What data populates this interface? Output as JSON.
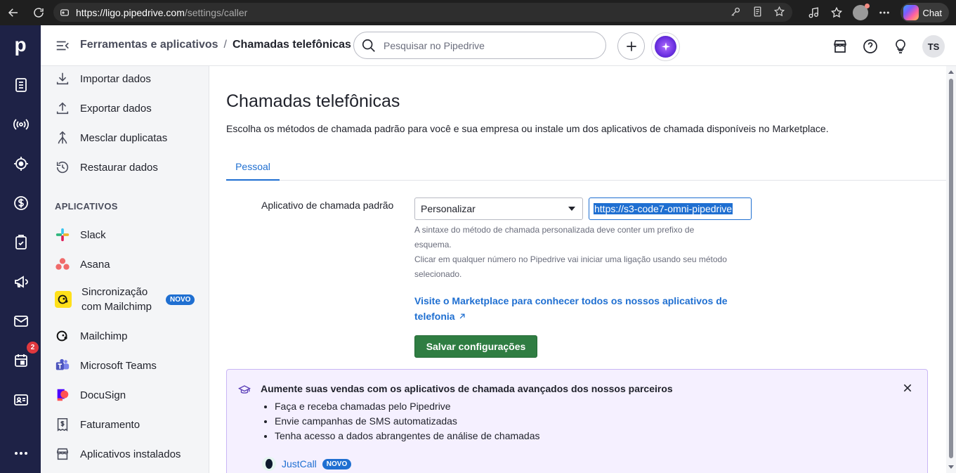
{
  "browser": {
    "url_host": "https://ligo.pipedrive.com",
    "url_path": "/settings/caller",
    "chat_label": "Chat"
  },
  "rail": {
    "logo": "p",
    "badge_count": "2"
  },
  "header": {
    "breadcrumb_parent": "Ferramentas e aplicativos",
    "breadcrumb_sep": "/",
    "breadcrumb_current": "Chamadas telefônicas",
    "search_placeholder": "Pesquisar no Pipedrive",
    "user_initials": "TS"
  },
  "sidebar": {
    "items": [
      {
        "label": "Importar dados",
        "icon": "import-icon"
      },
      {
        "label": "Exportar dados",
        "icon": "export-icon"
      },
      {
        "label": "Mesclar duplicatas",
        "icon": "merge-icon"
      },
      {
        "label": "Restaurar dados",
        "icon": "restore-icon"
      }
    ],
    "section_apps": "APLICATIVOS",
    "apps": [
      {
        "label": "Slack",
        "icon": "slack-icon"
      },
      {
        "label": "Asana",
        "icon": "asana-icon"
      },
      {
        "label_line1": "Sincronização",
        "label_line2": "com Mailchimp",
        "badge": "NOVO",
        "icon": "mailchimp-icon"
      },
      {
        "label": "Mailchimp",
        "icon": "mailchimp-icon"
      },
      {
        "label": "Microsoft Teams",
        "icon": "teams-icon"
      },
      {
        "label": "DocuSign",
        "icon": "docusign-icon"
      },
      {
        "label": "Faturamento",
        "icon": "billing-icon"
      },
      {
        "label": "Aplicativos instalados",
        "icon": "store-icon"
      }
    ]
  },
  "main": {
    "title": "Chamadas telefônicas",
    "description": "Escolha os métodos de chamada padrão para você e sua empresa ou instale um dos aplicativos de chamada disponíveis no Marketplace.",
    "tab_personal": "Pessoal",
    "field_label": "Aplicativo de chamada padrão",
    "select_value": "Personalizar",
    "url_value": "https://s3-code7-omni-pipedrive",
    "help_line1a": "A sintaxe do método de chamada personalizada deve conter um prefixo de",
    "help_line1b": "esquema.",
    "help_line2a": "Clicar em qualquer número no Pipedrive vai iniciar uma ligação usando seu método",
    "help_line2b": "selecionado.",
    "marketplace_link_line1": "Visite o Marketplace para conhecer todos os nossos aplicativos de",
    "marketplace_link_line2": "telefonia",
    "save_label": "Salvar configurações"
  },
  "promo": {
    "title": "Aumente suas vendas com os aplicativos de chamada avançados dos nossos parceiros",
    "bullets": [
      "Faça e receba chamadas pelo Pipedrive",
      "Envie campanhas de SMS automatizadas",
      "Tenha acesso a dados abrangentes de análise de chamadas"
    ],
    "partner_name": "JustCall",
    "partner_badge": "NOVO"
  }
}
